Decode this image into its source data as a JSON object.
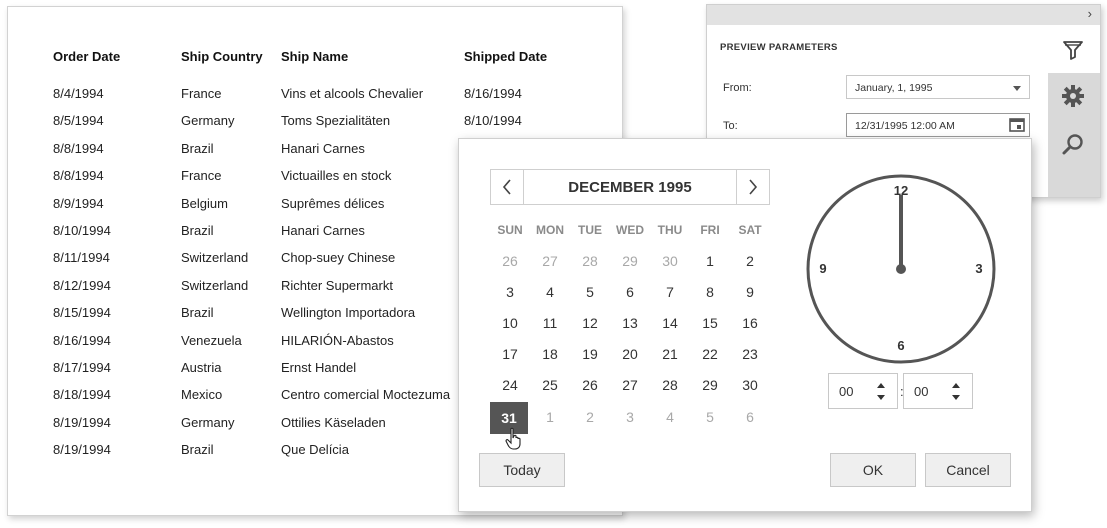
{
  "report": {
    "headers": [
      "Order Date",
      "Ship Country",
      "Ship Name",
      "Shipped Date"
    ],
    "rows": [
      [
        "8/4/1994",
        "France",
        "Vins et alcools Chevalier",
        "8/16/1994"
      ],
      [
        "8/5/1994",
        "Germany",
        "Toms Spezialitäten",
        "8/10/1994"
      ],
      [
        "8/8/1994",
        "Brazil",
        "Hanari Carnes",
        ""
      ],
      [
        "8/8/1994",
        "France",
        "Victuailles en stock",
        ""
      ],
      [
        "8/9/1994",
        "Belgium",
        "Suprêmes délices",
        ""
      ],
      [
        "8/10/1994",
        "Brazil",
        "Hanari Carnes",
        ""
      ],
      [
        "8/11/1994",
        "Switzerland",
        "Chop-suey Chinese",
        ""
      ],
      [
        "8/12/1994",
        "Switzerland",
        "Richter Supermarkt",
        ""
      ],
      [
        "8/15/1994",
        "Brazil",
        "Wellington Importadora",
        ""
      ],
      [
        "8/16/1994",
        "Venezuela",
        "HILARIÓN-Abastos",
        ""
      ],
      [
        "8/17/1994",
        "Austria",
        "Ernst Handel",
        ""
      ],
      [
        "8/18/1994",
        "Mexico",
        "Centro comercial Moctezuma",
        ""
      ],
      [
        "8/19/1994",
        "Germany",
        "Ottilies Käseladen",
        ""
      ],
      [
        "8/19/1994",
        "Brazil",
        "Que Delícia",
        ""
      ]
    ]
  },
  "params": {
    "collapse_icon": "chevron-right-icon",
    "title": "PREVIEW PARAMETERS",
    "from_label": "From:",
    "from_value": "January, 1, 1995",
    "to_label": "To:",
    "to_value": "12/31/1995 12:00 AM",
    "sidebar_icons": [
      "filter-icon",
      "gear-icon",
      "search-icon"
    ]
  },
  "picker": {
    "month_title": "DECEMBER 1995",
    "weekdays": [
      "SUN",
      "MON",
      "TUE",
      "WED",
      "THU",
      "FRI",
      "SAT"
    ],
    "weeks": [
      [
        "26",
        "27",
        "28",
        "29",
        "30",
        "1",
        "2"
      ],
      [
        "3",
        "4",
        "5",
        "6",
        "7",
        "8",
        "9"
      ],
      [
        "10",
        "11",
        "12",
        "13",
        "14",
        "15",
        "16"
      ],
      [
        "17",
        "18",
        "19",
        "20",
        "21",
        "22",
        "23"
      ],
      [
        "24",
        "25",
        "26",
        "27",
        "28",
        "29",
        "30"
      ],
      [
        "31",
        "1",
        "2",
        "3",
        "4",
        "5",
        "6"
      ]
    ],
    "selected_day": "31",
    "clock_labels": {
      "top": "12",
      "right": "3",
      "bottom": "6",
      "left": "9"
    },
    "hours": "00",
    "separator": ":",
    "minutes": "00",
    "today_label": "Today",
    "ok_label": "OK",
    "cancel_label": "Cancel"
  },
  "colors": {
    "selected_day_bg": "#555555",
    "sidebar_bg": "#d9d9d9",
    "clock_stroke": "#555555"
  }
}
